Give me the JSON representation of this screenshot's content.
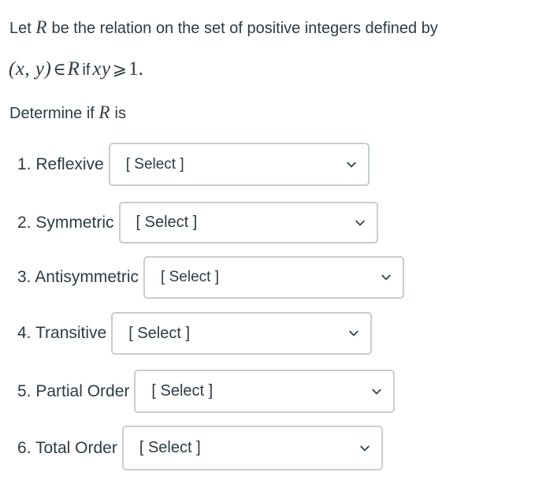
{
  "question": {
    "line_1": "Let R be the relation on the set of positive integers defined by",
    "line_1_parts": {
      "before": "Let",
      "variable": "R",
      "after": "be the relation on the set of positive integers defined by"
    },
    "line_2": "(x, y) ∈ R if xy ⩾ 1.",
    "line_2_parts": {
      "tuple": "(x, y)",
      "member_op": "∈",
      "relation": "R",
      "conjunction": "if",
      "product": "xy",
      "comparison_op": "⩾",
      "value": "1",
      "period": "."
    },
    "line_3": "Determine if R is",
    "line_3_parts": {
      "before": "Determine if",
      "variable": "R",
      "after": "is"
    }
  },
  "items": [
    {
      "number": "1.",
      "label": "1. Reflexive",
      "property": "Reflexive",
      "select_value": "[ Select ]",
      "chevron": "chevron-down-icon"
    },
    {
      "number": "2.",
      "label": "2. Symmetric",
      "property": "Symmetric",
      "select_value": "[ Select ]",
      "chevron": "chevron-down-icon"
    },
    {
      "number": "3.",
      "label": "3. Antisymmetric",
      "property": "Antisymmetric",
      "select_value": "[ Select ]",
      "chevron": "chevron-down-icon"
    },
    {
      "number": "4.",
      "label": "4. Transitive",
      "property": "Transitive",
      "select_value": "[ Select ]",
      "chevron": "chevron-down-icon"
    },
    {
      "number": "5.",
      "label": "5. Partial Order",
      "property": "Partial Order",
      "select_value": "[ Select ]",
      "chevron": "chevron-down-icon"
    },
    {
      "number": "6.",
      "label": "6. Total Order",
      "property": "Total Order",
      "select_value": "[ Select ]",
      "chevron": "chevron-down-icon"
    }
  ],
  "colors": {
    "text": "#2d3b45",
    "select_border": "#c7cdd1",
    "background": "#ffffff",
    "chevron": "#394b58"
  }
}
